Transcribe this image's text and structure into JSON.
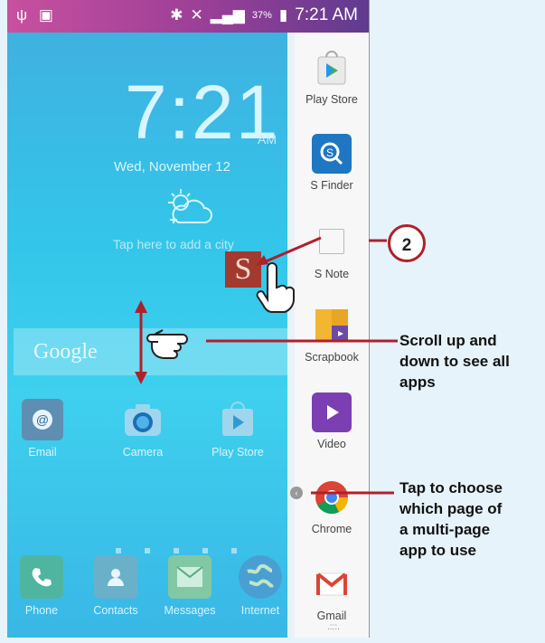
{
  "status_bar": {
    "battery": "37%",
    "time": "7:21 AM"
  },
  "lock_widget": {
    "time": "7:21",
    "ampm": "AM",
    "date": "Wed, November 12",
    "city_prompt": "Tap here to add a city"
  },
  "search": {
    "placeholder": "Google"
  },
  "home_apps": [
    {
      "label": "Email",
      "icon": "email-icon"
    },
    {
      "label": "Camera",
      "icon": "camera-icon"
    },
    {
      "label": "Play Store",
      "icon": "play-store-icon"
    }
  ],
  "dock_apps": [
    {
      "label": "Phone",
      "icon": "phone-icon"
    },
    {
      "label": "Contacts",
      "icon": "contacts-icon"
    },
    {
      "label": "Messages",
      "icon": "messages-icon"
    },
    {
      "label": "Internet",
      "icon": "internet-icon"
    }
  ],
  "sidebar_apps": [
    {
      "label": "Play Store",
      "icon": "play-store-icon"
    },
    {
      "label": "S Finder",
      "icon": "s-finder-icon"
    },
    {
      "label": "S Note",
      "icon": "s-note-icon"
    },
    {
      "label": "Scrapbook",
      "icon": "scrapbook-icon"
    },
    {
      "label": "Video",
      "icon": "video-icon"
    },
    {
      "label": "Chrome",
      "icon": "chrome-icon"
    },
    {
      "label": "Gmail",
      "icon": "gmail-icon"
    }
  ],
  "dragged_app": {
    "letter": "S"
  },
  "annotations": {
    "step_number": "2",
    "scroll_note": [
      "Scroll up and",
      "down to see all",
      "apps"
    ],
    "tap_note": [
      "Tap to choose",
      "which page of",
      "a multi-page",
      "app to use"
    ]
  },
  "colors": {
    "callout_line": "#b0202a",
    "status_bar": "#9a3f97",
    "home_bg": "#33c6ea"
  }
}
